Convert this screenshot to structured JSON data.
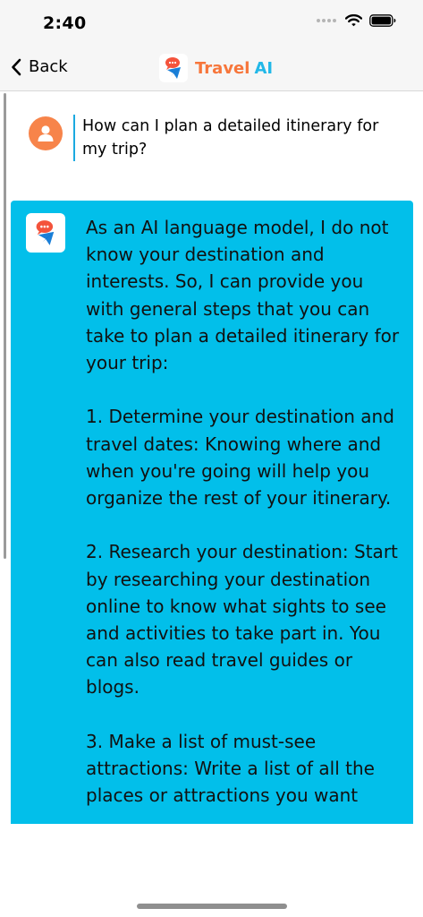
{
  "status_bar": {
    "time": "2:40"
  },
  "nav": {
    "back_label": "Back",
    "title_part1": "Travel",
    "title_part2": "AI"
  },
  "conversation": {
    "user_question": "How can I plan a detailed itinerary for my trip?",
    "ai_response": {
      "intro": "As an AI language model, I do not know your destination and interests. So, I can provide you with general steps that you can take to plan a detailed itinerary for your trip:",
      "step1": "1. Determine your destination and travel dates: Knowing where and when you're going will help you organize the rest of your itinerary.",
      "step2": "2. Research your destination: Start by researching your destination online to know what sights to see and activities to take part in. You can also read travel guides or blogs.",
      "step3": "3. Make a list of must-see attractions: Write a list of all the places or attractions you want"
    }
  },
  "colors": {
    "accent_orange": "#f7763b",
    "accent_blue": "#22b8e8",
    "ai_card": "#02bfea"
  },
  "icons": [
    "back-chevron-icon",
    "wifi-icon",
    "battery-icon",
    "cellular-signal-icon",
    "travel-ai-logo-icon",
    "user-avatar-icon"
  ]
}
